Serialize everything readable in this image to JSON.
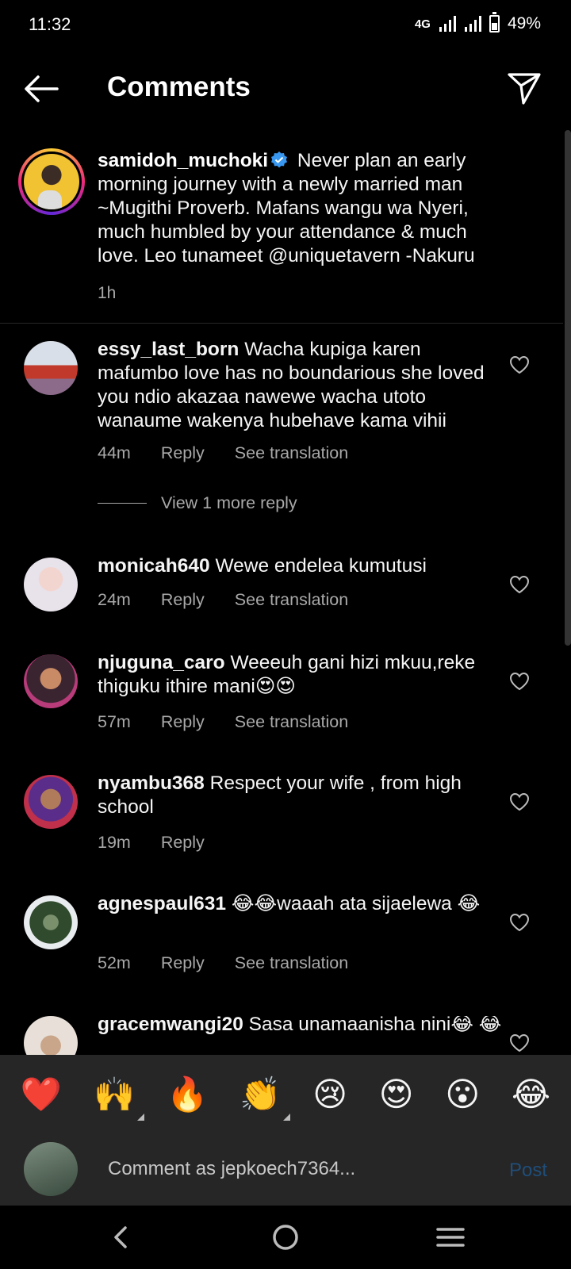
{
  "status": {
    "time": "11:32",
    "network": "4G",
    "battery": "49%",
    "battery_level": 0.49
  },
  "header": {
    "title": "Comments"
  },
  "caption": {
    "username": "samidoh_muchoki",
    "text": "Never plan an early morning journey with a newly married man ~Mugithi Proverb. Mafans wangu wa Nyeri, much humbled by your attendance & much love.  Leo tunameet @uniquetavern -Nakuru",
    "time": "1h"
  },
  "comments": [
    {
      "username": "essy_last_born",
      "text": "Wacha kupiga karen mafumbo love has no boundarious she loved you ndio akazaa nawewe wacha utoto wanaume wakenya hubehave kama vihii",
      "time": "44m",
      "reply": "Reply",
      "translate": "See translation"
    },
    {
      "username": "monicah640",
      "text": "Wewe endelea kumutusi",
      "time": "24m",
      "reply": "Reply",
      "translate": "See translation"
    },
    {
      "username": "njuguna_caro",
      "text": "Weeeuh gani hizi mkuu,reke thiguku ithire mani😍😍",
      "time": "57m",
      "reply": "Reply",
      "translate": "See translation"
    },
    {
      "username": "nyambu368",
      "text": "Respect your wife , from high school",
      "time": "19m",
      "reply": "Reply",
      "translate": ""
    },
    {
      "username": "agnespaul631",
      "text": "😂😂waaah ata sijaelewa 😂",
      "time": "52m",
      "reply": "Reply",
      "translate": "See translation"
    },
    {
      "username": "gracemwangi20",
      "text": "Sasa unamaanisha nini😂 😂",
      "time": "",
      "reply": "",
      "translate": ""
    }
  ],
  "view_more": "View 1 more reply",
  "emojis": [
    "❤️",
    "🙌",
    "🔥",
    "👏",
    "😢",
    "😍",
    "😮",
    "😂"
  ],
  "composer": {
    "placeholder": "Comment as jepkoech7364...",
    "post": "Post"
  }
}
